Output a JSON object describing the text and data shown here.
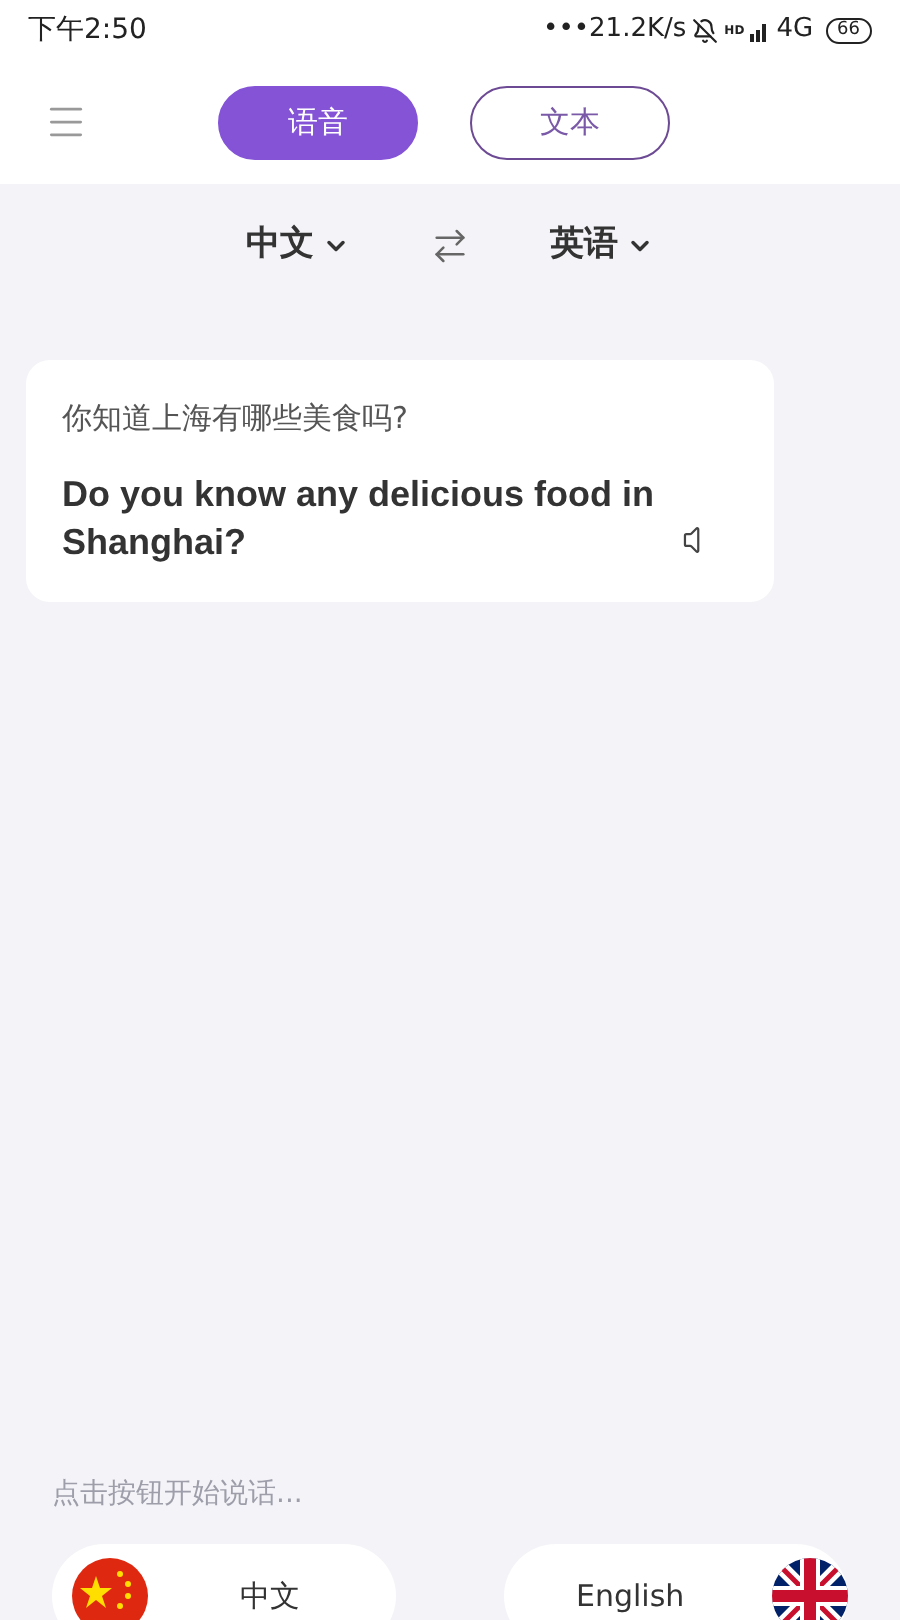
{
  "status_bar": {
    "time": "下午2:50",
    "speed": "•••21.2K/s",
    "hd": "HD",
    "network": "4G",
    "battery": "66"
  },
  "tabs": [
    {
      "label": "语音",
      "selected": true
    },
    {
      "label": "文本",
      "selected": false
    }
  ],
  "language_bar": {
    "source": "中文",
    "target": "英语"
  },
  "translations": [
    {
      "source_text": "你知道上海有哪些美食吗?",
      "translated_text": "Do you know any delicious food in Shanghai?"
    }
  ],
  "hint": "点击按钮开始说话...",
  "speak_buttons": [
    {
      "label": "中文",
      "kind": "china"
    },
    {
      "label": "English",
      "kind": "uk"
    }
  ]
}
